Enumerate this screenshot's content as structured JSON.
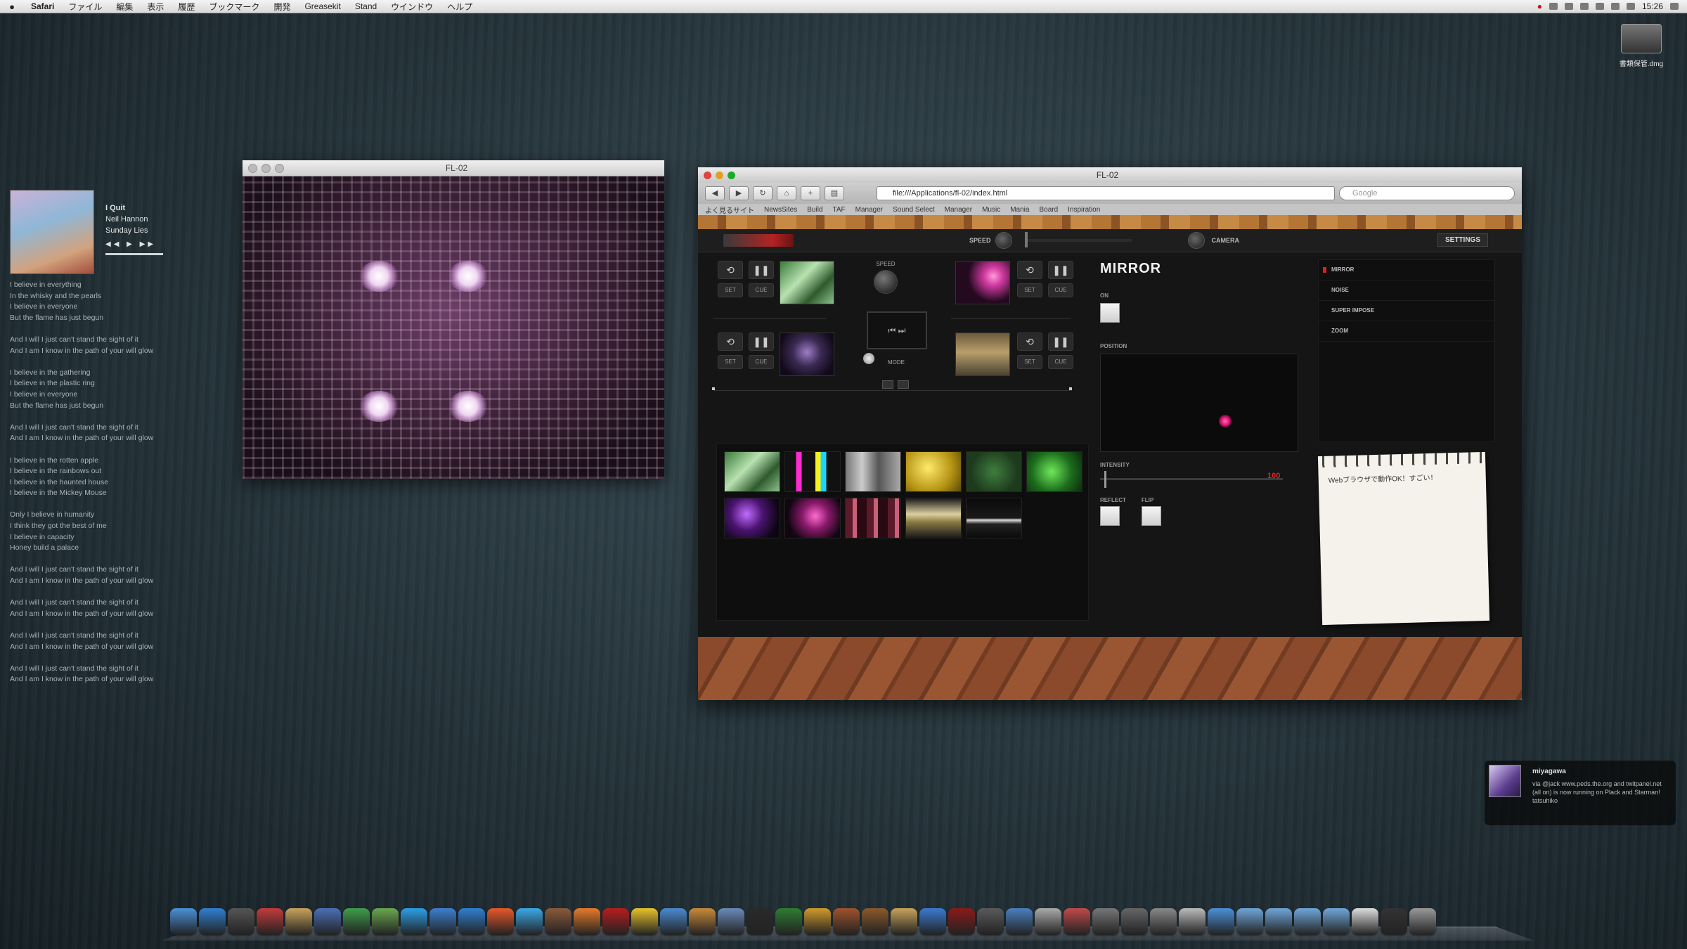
{
  "menubar": {
    "app_name": "Safari",
    "items": [
      "ファイル",
      "編集",
      "表示",
      "履歴",
      "ブックマーク",
      "開発",
      "Greasekit",
      "Stand",
      "ウインドウ",
      "ヘルプ"
    ],
    "clock": "15:26"
  },
  "desktop": {
    "drive_label": "書類保管.dmg"
  },
  "music": {
    "track": "I Quit",
    "artist": "Neil Hannon",
    "album": "Sunday Lies",
    "controls": "◀◀ ▶ ▶▶",
    "lyrics": "I believe in everything\nIn the whisky and the pearls\nI believe in everyone\nBut the flame has just begun\n\nAnd I will I just can't stand the sight of it\nAnd I am I know in the path of your will glow\n\nI believe in the gathering\nI believe in the plastic ring\nI believe in everyone\nBut the flame has just begun\n\nAnd I will I just can't stand the sight of it\nAnd I am I know in the path of your will glow\n\nI believe in the rotten apple\nI believe in the rainbows out\nI believe in the haunted house\nI believe in the Mickey Mouse\n\nOnly I believe in humanity\nI think they got the best of me\nI believe in capacity\nHoney build a palace\n\nAnd I will I just can't stand the sight of it\nAnd I am I know in the path of your will glow\n\nAnd I will I just can't stand the sight of it\nAnd I am I know in the path of your will glow\n\nAnd I will I just can't stand the sight of it\nAnd I am I know in the path of your will glow\n\nAnd I will I just can't stand the sight of it\nAnd I am I know in the path of your will glow"
  },
  "video_window": {
    "title": "FL-02"
  },
  "safari": {
    "title": "FL-02",
    "url": "file:///Applications/fl-02/index.html",
    "search_placeholder": "Google",
    "bookmarks": [
      "よく見るサイト",
      "NewsSites",
      "Build",
      "TAF",
      "Manager",
      "Sound Select",
      "Manager",
      "Music",
      "Mania",
      "Board",
      "Inspiration"
    ]
  },
  "app": {
    "speed_label": "SPEED",
    "camera_label": "CAMERA",
    "settings_label": "SETTINGS",
    "deck_labels": {
      "set": "SET",
      "cue": "CUE"
    },
    "mixer_speed_label": "SPEED",
    "mixer_mode_label": "MODE",
    "mixer_icons": "⏮ ⏭",
    "effect": {
      "name": "MIRROR",
      "on_label": "ON",
      "position_label": "POSITION",
      "intensity_label": "INTENSITY",
      "intensity_value": "100",
      "reflect_label": "REFLECT",
      "flip_label": "FLIP"
    },
    "effect_list": [
      "MIRROR",
      "NOISE",
      "SUPER IMPOSE",
      "ZOOM"
    ],
    "note_text": "Webブラウザで動作OK！すごい！"
  },
  "notification": {
    "user": "miyagawa",
    "message": "via @jack www.peds.the.org and twitpanel.net (all on) is now running on Plack and Starman! tatsuhiko"
  },
  "dock": {
    "icons": [
      "finder-icon",
      "safari-icon",
      "clock-icon",
      "calendar-icon",
      "notes-icon",
      "preview-icon",
      "green-icon",
      "maps-icon",
      "skype-icon",
      "appstore-icon",
      "safari2-icon",
      "soundcloud-icon",
      "twitter-icon",
      "game-icon",
      "firefox-icon",
      "ruby-icon",
      "chrome-icon",
      "network-icon",
      "box-icon",
      "preview2-icon",
      "terminal-icon",
      "vim-icon",
      "tools-icon",
      "pen-icon",
      "guitar-icon",
      "paint-icon",
      "brush-icon",
      "bottle-icon",
      "photo-icon",
      "mail-icon",
      "dj-icon",
      "puzzle-icon",
      "calc-icon",
      "tool2-icon",
      "gear-icon",
      "bulb-icon",
      "dl-icon",
      "folder-icon",
      "folder2-icon",
      "folder3-icon",
      "folder4-icon",
      "doc-icon",
      "stack-icon",
      "trash-icon"
    ]
  }
}
